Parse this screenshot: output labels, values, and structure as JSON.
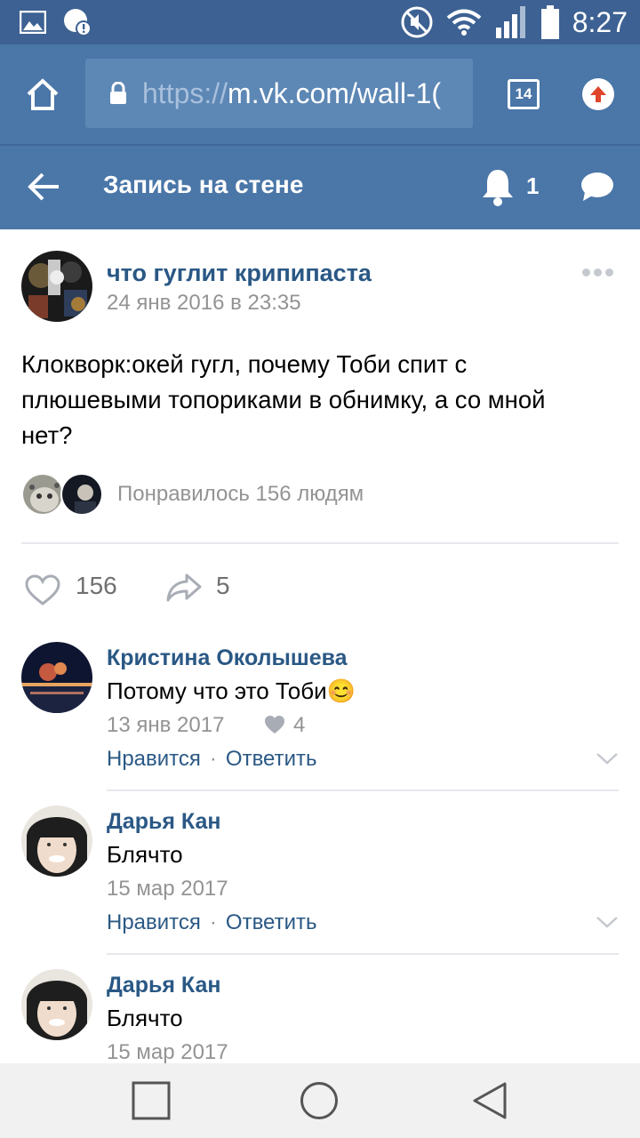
{
  "status_bar": {
    "time": "8:27",
    "icons": [
      "image-icon",
      "alert-icon",
      "mute-icon",
      "wifi-icon",
      "signal-icon",
      "battery-icon"
    ]
  },
  "browser": {
    "url_scheme": "https://",
    "url_host": "m.vk.com/wall-1(",
    "tab_count": "14",
    "icons": [
      "home-icon",
      "lock-icon",
      "update-icon"
    ]
  },
  "header": {
    "title": "Запись на стене",
    "notification_count": "1",
    "icons": [
      "back-arrow-icon",
      "bell-icon",
      "chat-icon"
    ]
  },
  "post": {
    "author": "что гуглит крипипаста",
    "date": "24 янв 2016 в 23:35",
    "text_line1": "Клокворк:окей гугл, почему Тоби спит с",
    "text_line2": "плюшевыми топориками в обнимку, а со мной",
    "text_line3": "нет?",
    "likers_text": "Понравилось 156 людям",
    "like_count": "156",
    "share_count": "5"
  },
  "comments": [
    {
      "name": "Кристина Околышева",
      "text": "Потому что это Тоби",
      "emoji": "😊",
      "date": "13 янв 2017",
      "likes": "4",
      "like_label": "Нравится",
      "reply_label": "Ответить",
      "separator": "·"
    },
    {
      "name": "Дарья Кан",
      "text": "Блячто",
      "date": "15 мар 2017",
      "like_label": "Нравится",
      "reply_label": "Ответить",
      "separator": "·"
    },
    {
      "name": "Дарья Кан",
      "text": "Блячто",
      "date": "15 мар 2017"
    }
  ],
  "colors": {
    "vk_blue": "#4a76a8",
    "status_bar": "#3d6192",
    "link_blue": "#2a5885",
    "meta_gray": "#939393"
  }
}
